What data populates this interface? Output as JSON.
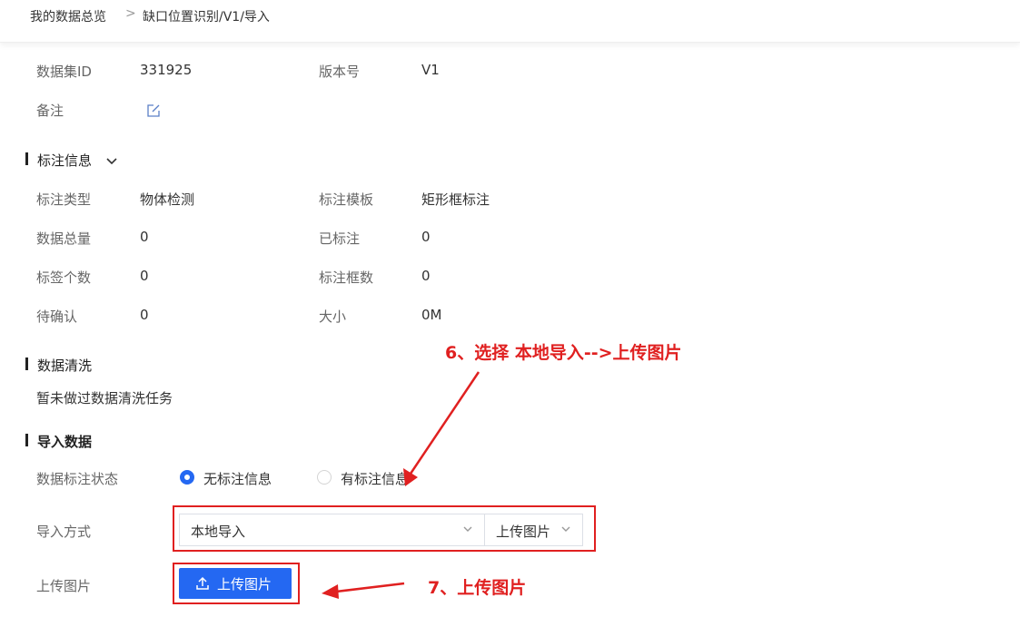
{
  "breadcrumb": {
    "root": "我的数据总览",
    "separator": ">",
    "current": "缺口位置识别/V1/导入"
  },
  "basic": {
    "dataset_id_label": "数据集ID",
    "dataset_id": "331925",
    "version_label": "版本号",
    "version": "V1",
    "note_label": "备注"
  },
  "annotation": {
    "title": "标注信息",
    "type_label": "标注类型",
    "type": "物体检测",
    "template_label": "标注模板",
    "template": "矩形框标注",
    "total_label": "数据总量",
    "total": "0",
    "labeled_label": "已标注",
    "labeled": "0",
    "tags_label": "标签个数",
    "tags": "0",
    "boxes_label": "标注框数",
    "boxes": "0",
    "pending_label": "待确认",
    "pending": "0",
    "size_label": "大小",
    "size": "0M"
  },
  "cleaning": {
    "title": "数据清洗",
    "empty_text": "暂未做过数据清洗任务"
  },
  "import": {
    "title": "导入数据",
    "status_label": "数据标注状态",
    "option_none": "无标注信息",
    "option_has": "有标注信息",
    "method_label": "导入方式",
    "method_value": "本地导入",
    "method_sub_value": "上传图片",
    "upload_label": "上传图片",
    "upload_button": "上传图片"
  },
  "annotations_overlay": {
    "step6": "6、选择 本地导入-->上传图片",
    "step7": "7、上传图片"
  },
  "colors": {
    "primary": "#2468f2",
    "annotation_red": "#e02020"
  }
}
